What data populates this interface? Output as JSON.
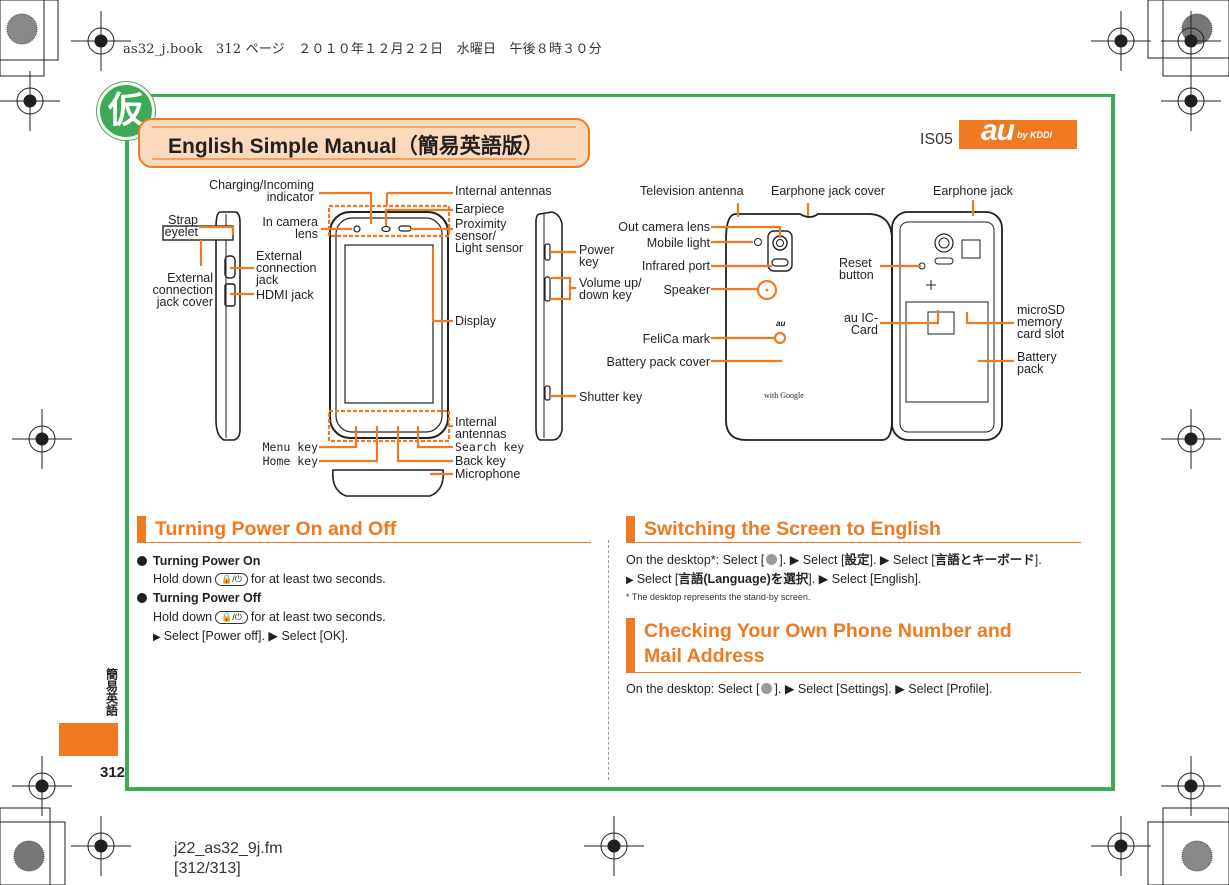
{
  "print_header": "as32_j.book　312 ページ　２０１０年１２月２２日　水曜日　午後８時３０分",
  "footer_file": {
    "name": "j22_as32_9j.fm",
    "pages": "[312/313]"
  },
  "draft_mark": "仮",
  "title": "English Simple Manual（簡易英語版）",
  "model": "IS05",
  "brand": {
    "au": "au",
    "by": "by KDDI",
    "color": "#ef7a22"
  },
  "side_tab": {
    "label": "簡易英語",
    "page": "312"
  },
  "colors": {
    "accent": "#ef7a22",
    "frame": "#3daa56",
    "title_fill": "#fbd9bd"
  },
  "diagram": {
    "side_left": {
      "strap_eyelet": "Strap\neyelet",
      "ext_jack_cover": "External\nconnection\njack cover",
      "ext_jack": "External\nconnection\njack",
      "hdmi": "HDMI jack"
    },
    "front": {
      "charging": "Charging/Incoming\nindicator",
      "in_camera": "In camera\nlens",
      "internal_antennas_top": "Internal antennas",
      "earpiece": "Earpiece",
      "proximity": "Proximity\nsensor/\nLight sensor",
      "display": "Display",
      "internal_antennas_bottom": "Internal\nantennas",
      "menu_key": "Menu key",
      "home_key": "Home key",
      "search_key": "Search key",
      "back_key": "Back key",
      "microphone": "Microphone"
    },
    "side_right": {
      "power_key": "Power\nkey",
      "volume_key": "Volume up/\ndown key",
      "shutter_key": "Shutter key"
    },
    "back": {
      "tv_antenna": "Television antenna",
      "earphone_cover": "Earphone jack cover",
      "out_camera": "Out camera lens",
      "mobile_light": "Mobile light",
      "infrared": "Infrared port",
      "speaker": "Speaker",
      "felica": "FeliCa mark",
      "battery_cover": "Battery pack cover",
      "google": "with Google"
    },
    "inside": {
      "earphone_jack": "Earphone jack",
      "reset": "Reset\nbutton",
      "au_ic": "au IC-\nCard",
      "microsd": "microSD\nmemory\ncard slot",
      "battery": "Battery\npack"
    }
  },
  "sections": {
    "power": {
      "heading": "Turning Power On and Off",
      "on_title": "Turning Power On",
      "on_pre": "Hold down",
      "on_post": "for at least two seconds.",
      "off_title": "Turning Power Off",
      "off_pre": "Hold down",
      "off_post": "for at least two seconds.",
      "off_steps": "Select [Power off]. ▶ Select [OK].",
      "key_label": "🔒/⏻"
    },
    "english": {
      "heading": "Switching the Screen to English",
      "line1_pre": "On the desktop*: Select [",
      "line1_mid": "]. ▶ Select [",
      "settings_jp": "設定",
      "line1_mid2": "]. ▶ Select [",
      "lang_kb_jp": "言語とキーボード",
      "line1_end": "].",
      "line2_pre": "Select [",
      "lang_select_jp": "言語(Language)を選択",
      "line2_end": "]. ▶ Select [English].",
      "footnote": "*  The desktop represents the stand-by screen."
    },
    "phone_number": {
      "heading_line1": "Checking Your Own Phone Number and",
      "heading_line2": "Mail Address",
      "line_pre": "On the desktop: Select [",
      "line_end": "]. ▶ Select [Settings]. ▶ Select [Profile]."
    }
  }
}
